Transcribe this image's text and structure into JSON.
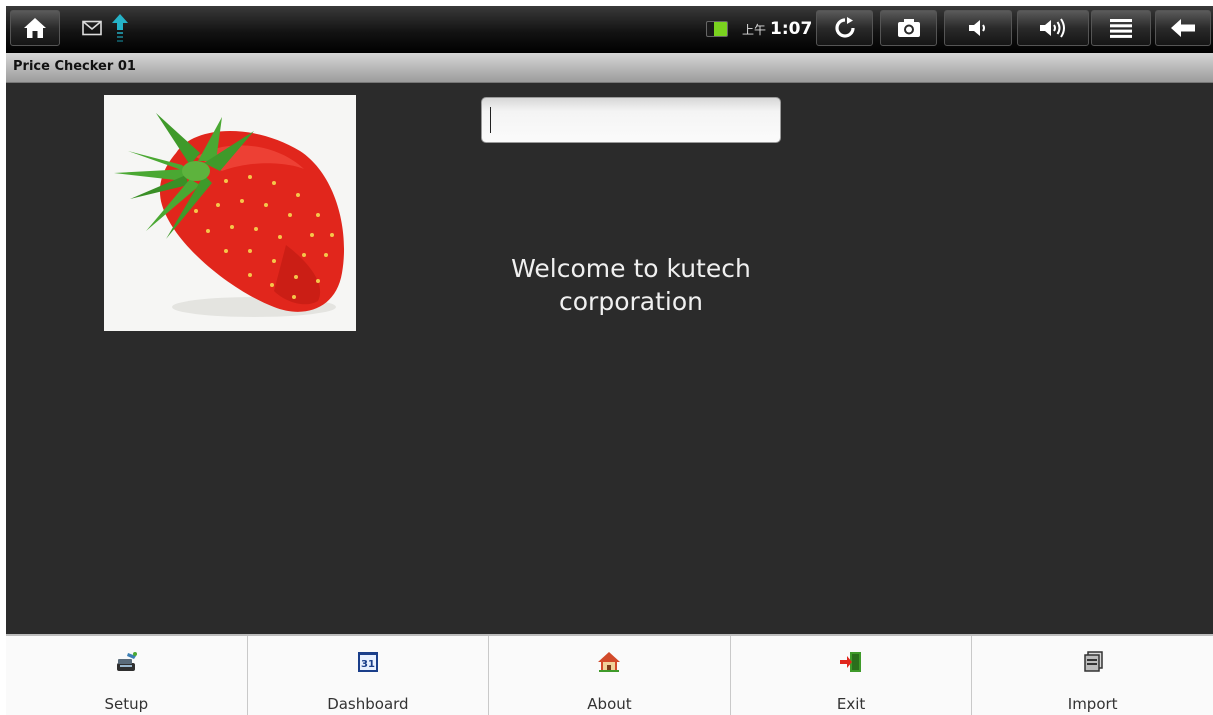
{
  "status_bar": {
    "ampm": "上午",
    "time": "1:07",
    "icons": [
      "home-icon",
      "gmail-icon",
      "upload-icon",
      "battery-icon",
      "refresh-icon",
      "camera-icon",
      "volume-down-icon",
      "volume-up-icon",
      "menu-icon",
      "back-icon"
    ]
  },
  "app": {
    "title": "Price Checker 01"
  },
  "main": {
    "search": {
      "value": "",
      "placeholder": ""
    },
    "welcome_line1": "Welcome to kutech",
    "welcome_line2": "corporation"
  },
  "bottom_menu": {
    "items": [
      {
        "label": "Setup",
        "icon": "setup-icon"
      },
      {
        "label": "Dashboard",
        "icon": "calendar-icon"
      },
      {
        "label": "About",
        "icon": "house-icon"
      },
      {
        "label": "Exit",
        "icon": "exit-door-icon"
      },
      {
        "label": "Import",
        "icon": "import-icon"
      }
    ]
  },
  "colors": {
    "background": "#2b2b2b",
    "title_bar": "#b8b8b8",
    "strawberry_red": "#e1261c",
    "leaf_green": "#3f9a2a",
    "battery_green": "#7ad21f"
  }
}
